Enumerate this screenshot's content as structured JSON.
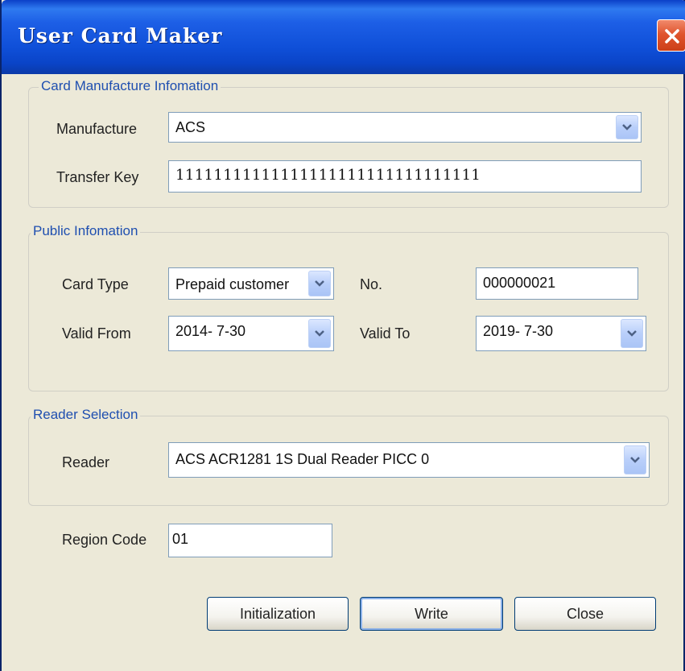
{
  "window": {
    "title": "User Card Maker"
  },
  "manufacture_group": {
    "legend": "Card Manufacture Infomation",
    "manufacture_label": "Manufacture",
    "manufacture_value": "ACS",
    "transfer_key_label": "Transfer Key",
    "transfer_key_value": "11111111111111111111111111111111"
  },
  "public_group": {
    "legend": "Public Infomation",
    "card_type_label": "Card Type",
    "card_type_value": "Prepaid customer",
    "no_label": "No.",
    "no_value": "000000021",
    "valid_from_label": "Valid From",
    "valid_from_value": "2014- 7-30",
    "valid_to_label": "Valid To",
    "valid_to_value": "2019- 7-30"
  },
  "reader_group": {
    "legend": "Reader Selection",
    "reader_label": "Reader",
    "reader_value": "ACS ACR1281 1S Dual Reader PICC 0"
  },
  "region": {
    "label": "Region Code",
    "value": "01"
  },
  "buttons": {
    "initialization": "Initialization",
    "write": "Write",
    "close": "Close"
  },
  "colors": {
    "titlebar": "#1d5fe6",
    "window_bg": "#ece9d8",
    "legend_text": "#1f4fb0",
    "close_button": "#e0552e"
  }
}
